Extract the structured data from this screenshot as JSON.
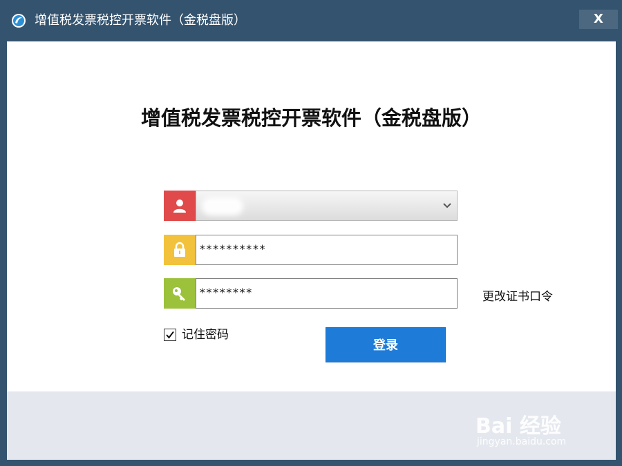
{
  "window": {
    "title": "增值税发票税控开票软件（金税盘版）",
    "close_label": "X"
  },
  "main": {
    "title": "增值税发票税控开票软件（金税盘版）"
  },
  "form": {
    "user": {
      "value": "",
      "icon": "user-icon"
    },
    "password": {
      "value": "**********",
      "icon": "lock-icon"
    },
    "cert_password": {
      "value": "********",
      "icon": "key-icon"
    },
    "change_cert_label": "更改证书口令",
    "remember_label": "记住密码",
    "remember_checked": true,
    "login_label": "登录"
  },
  "watermark": {
    "text": "Bai 经验",
    "sub": "jingyan.baidu.com"
  },
  "colors": {
    "titlebar": "#34536e",
    "user_icon_bg": "#e04a4a",
    "lock_icon_bg": "#f2c23c",
    "key_icon_bg": "#9cc13a",
    "login_button": "#1e7cd8"
  }
}
